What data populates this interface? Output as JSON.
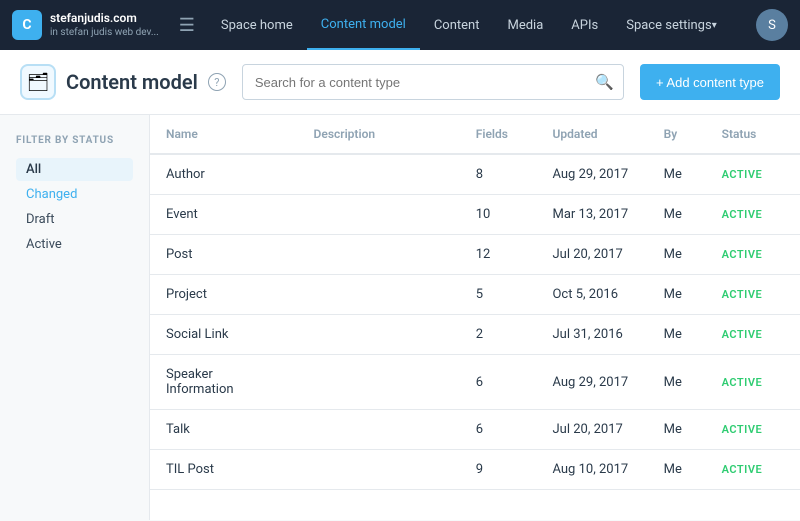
{
  "brand": {
    "site": "stefanjudis.com",
    "sub": "in stefan judis web dev...",
    "logo_text": "C"
  },
  "nav": {
    "hamburger": "☰",
    "links": [
      {
        "label": "Space home",
        "active": false
      },
      {
        "label": "Content model",
        "active": true
      },
      {
        "label": "Content",
        "active": false
      },
      {
        "label": "Media",
        "active": false
      },
      {
        "label": "APIs",
        "active": false
      },
      {
        "label": "Space settings",
        "active": false,
        "hasArrow": true
      }
    ],
    "avatar_text": "S"
  },
  "page": {
    "icon": "🗂",
    "title": "Content model",
    "help_label": "?",
    "add_button": "+ Add content type"
  },
  "search": {
    "placeholder": "Search for a content type"
  },
  "sidebar": {
    "filter_label": "Filter by status",
    "items": [
      {
        "label": "All",
        "type": "all",
        "active": true
      },
      {
        "label": "Changed",
        "type": "changed"
      },
      {
        "label": "Draft",
        "type": "draft"
      },
      {
        "label": "Active",
        "type": "active"
      }
    ]
  },
  "table": {
    "columns": [
      {
        "label": "Name"
      },
      {
        "label": "Description"
      },
      {
        "label": "Fields"
      },
      {
        "label": "Updated"
      },
      {
        "label": "By"
      },
      {
        "label": "Status"
      }
    ],
    "rows": [
      {
        "name": "Author",
        "description": "",
        "fields": "8",
        "updated": "Aug 29, 2017",
        "by": "Me",
        "status": "ACTIVE"
      },
      {
        "name": "Event",
        "description": "",
        "fields": "10",
        "updated": "Mar 13, 2017",
        "by": "Me",
        "status": "ACTIVE"
      },
      {
        "name": "Post",
        "description": "",
        "fields": "12",
        "updated": "Jul 20, 2017",
        "by": "Me",
        "status": "ACTIVE"
      },
      {
        "name": "Project",
        "description": "",
        "fields": "5",
        "updated": "Oct 5, 2016",
        "by": "Me",
        "status": "ACTIVE"
      },
      {
        "name": "Social Link",
        "description": "",
        "fields": "2",
        "updated": "Jul 31, 2016",
        "by": "Me",
        "status": "ACTIVE"
      },
      {
        "name": "Speaker Information",
        "description": "",
        "fields": "6",
        "updated": "Aug 29, 2017",
        "by": "Me",
        "status": "ACTIVE"
      },
      {
        "name": "Talk",
        "description": "",
        "fields": "6",
        "updated": "Jul 20, 2017",
        "by": "Me",
        "status": "ACTIVE"
      },
      {
        "name": "TIL Post",
        "description": "",
        "fields": "9",
        "updated": "Aug 10, 2017",
        "by": "Me",
        "status": "ACTIVE"
      }
    ]
  }
}
